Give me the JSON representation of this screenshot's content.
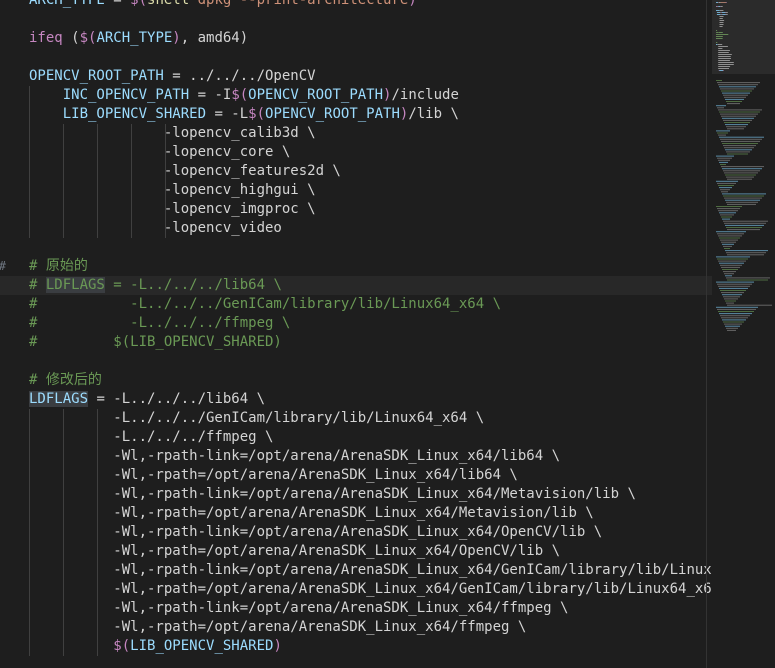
{
  "editor": {
    "gutter_marks": [
      "",
      "",
      "",
      "",
      "",
      "",
      "",
      "",
      "",
      "",
      "",
      "",
      "",
      "",
      "#",
      "",
      "",
      "",
      "",
      "",
      "",
      "",
      "",
      "",
      "",
      "",
      "",
      "",
      "",
      "",
      "",
      "",
      "",
      "",
      "",
      ""
    ],
    "lines": [
      [
        {
          "t": "ARCH_TYPE",
          "c": "var"
        },
        {
          "t": " = ",
          "c": "plain"
        },
        {
          "t": "$(",
          "c": "dollar"
        },
        {
          "t": "shell",
          "c": "fn"
        },
        {
          "t": " dpkg --print-architecture",
          "c": "str"
        },
        {
          "t": ")",
          "c": "dollar"
        }
      ],
      [],
      [
        {
          "t": "ifeq",
          "c": "kw"
        },
        {
          "t": " (",
          "c": "plain"
        },
        {
          "t": "$(",
          "c": "dollar"
        },
        {
          "t": "ARCH_TYPE",
          "c": "var"
        },
        {
          "t": ")",
          "c": "dollar"
        },
        {
          "t": ", amd64)",
          "c": "plain"
        }
      ],
      [],
      [
        {
          "t": "OPENCV_ROOT_PATH",
          "c": "var"
        },
        {
          "t": " = ../../../OpenCV",
          "c": "plain"
        }
      ],
      [
        {
          "t": "    INC_OPENCV_PATH",
          "c": "var"
        },
        {
          "t": " = -I",
          "c": "plain"
        },
        {
          "t": "$(",
          "c": "dollar"
        },
        {
          "t": "OPENCV_ROOT_PATH",
          "c": "var"
        },
        {
          "t": ")",
          "c": "dollar"
        },
        {
          "t": "/include",
          "c": "plain"
        }
      ],
      [
        {
          "t": "    LIB_OPENCV_SHARED",
          "c": "var"
        },
        {
          "t": " = -L",
          "c": "plain"
        },
        {
          "t": "$(",
          "c": "dollar"
        },
        {
          "t": "OPENCV_ROOT_PATH",
          "c": "var"
        },
        {
          "t": ")",
          "c": "dollar"
        },
        {
          "t": "/lib \\",
          "c": "plain"
        }
      ],
      [
        {
          "t": "                -lopencv_calib3d \\",
          "c": "plain"
        }
      ],
      [
        {
          "t": "                -lopencv_core \\",
          "c": "plain"
        }
      ],
      [
        {
          "t": "                -lopencv_features2d \\",
          "c": "plain"
        }
      ],
      [
        {
          "t": "                -lopencv_highgui \\",
          "c": "plain"
        }
      ],
      [
        {
          "t": "                -lopencv_imgproc \\",
          "c": "plain"
        }
      ],
      [
        {
          "t": "                -lopencv_video",
          "c": "plain"
        }
      ],
      [],
      [
        {
          "t": "# 原始的",
          "c": "cmt"
        }
      ],
      [
        {
          "t": "# ",
          "c": "cmt"
        },
        {
          "t": "LDFLAGS",
          "c": "selc"
        },
        {
          "t": " = -L../../../lib64 \\",
          "c": "cmt"
        }
      ],
      [
        {
          "t": "#           -L../../../GenICam/library/lib/Linux64_x64 \\",
          "c": "cmt"
        }
      ],
      [
        {
          "t": "#           -L../../../ffmpeg \\",
          "c": "cmt"
        }
      ],
      [
        {
          "t": "#         $(LIB_OPENCV_SHARED)",
          "c": "cmt"
        }
      ],
      [],
      [
        {
          "t": "# 修改后的",
          "c": "cmt"
        }
      ],
      [
        {
          "t": "LDFLAGS",
          "c": "sel"
        },
        {
          "t": " = -L../../../lib64 \\",
          "c": "plain"
        }
      ],
      [
        {
          "t": "          -L../../../GenICam/library/lib/Linux64_x64 \\",
          "c": "plain"
        }
      ],
      [
        {
          "t": "          -L../../../ffmpeg \\",
          "c": "plain"
        }
      ],
      [
        {
          "t": "          -Wl,-rpath-link=/opt/arena/ArenaSDK_Linux_x64/lib64 \\",
          "c": "plain"
        }
      ],
      [
        {
          "t": "          -Wl,-rpath=/opt/arena/ArenaSDK_Linux_x64/lib64 \\",
          "c": "plain"
        }
      ],
      [
        {
          "t": "          -Wl,-rpath-link=/opt/arena/ArenaSDK_Linux_x64/Metavision/lib \\",
          "c": "plain"
        }
      ],
      [
        {
          "t": "          -Wl,-rpath=/opt/arena/ArenaSDK_Linux_x64/Metavision/lib \\",
          "c": "plain"
        }
      ],
      [
        {
          "t": "          -Wl,-rpath-link=/opt/arena/ArenaSDK_Linux_x64/OpenCV/lib \\",
          "c": "plain"
        }
      ],
      [
        {
          "t": "          -Wl,-rpath=/opt/arena/ArenaSDK_Linux_x64/OpenCV/lib \\",
          "c": "plain"
        }
      ],
      [
        {
          "t": "          -Wl,-rpath-link=/opt/arena/ArenaSDK_Linux_x64/GenICam/library/lib/Linux",
          "c": "plain"
        }
      ],
      [
        {
          "t": "          -Wl,-rpath=/opt/arena/ArenaSDK_Linux_x64/GenICam/library/lib/Linux64_x6",
          "c": "plain"
        }
      ],
      [
        {
          "t": "          -Wl,-rpath-link=/opt/arena/ArenaSDK_Linux_x64/ffmpeg \\",
          "c": "plain"
        }
      ],
      [
        {
          "t": "          -Wl,-rpath=/opt/arena/ArenaSDK_Linux_x64/ffmpeg \\",
          "c": "plain"
        }
      ],
      [
        {
          "t": "          ",
          "c": "plain"
        },
        {
          "t": "$(",
          "c": "dollar"
        },
        {
          "t": "LIB_OPENCV_SHARED",
          "c": "var"
        },
        {
          "t": ")",
          "c": "dollar"
        }
      ]
    ]
  },
  "colors": {
    "background": "#1e1e1e",
    "variable": "#9cdcfe",
    "keyword": "#c586c0",
    "function": "#dcdcaa",
    "string": "#ce9178",
    "comment": "#6a9955",
    "text": "#d4d4d4"
  }
}
